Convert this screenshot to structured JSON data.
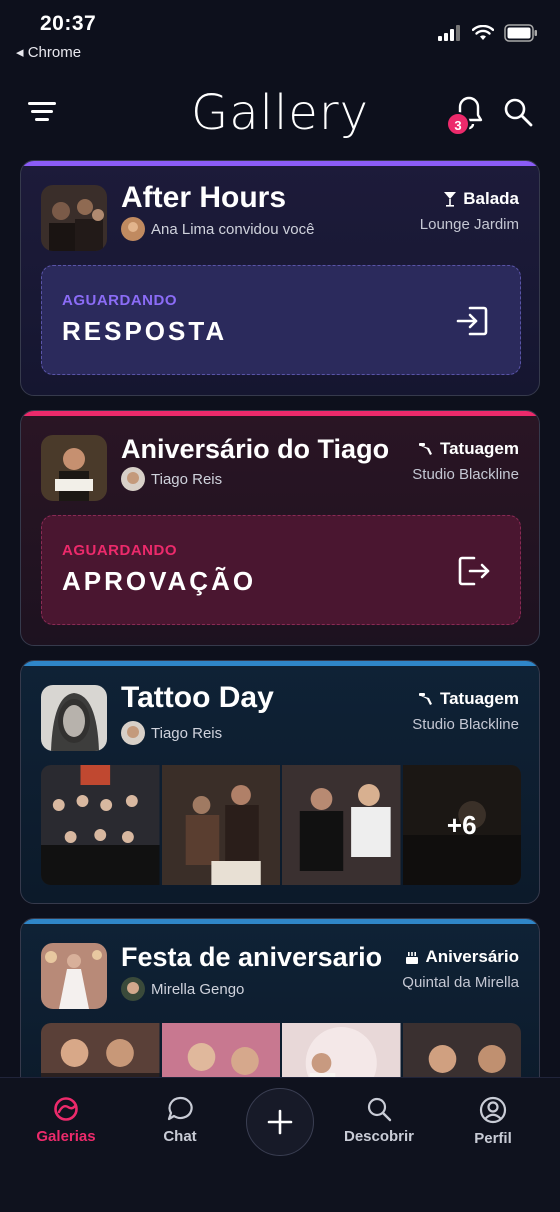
{
  "status_bar": {
    "time": "20:37",
    "back_label": "◂ Chrome"
  },
  "header": {
    "logo": "Gallery",
    "notification_count": "3"
  },
  "cards": [
    {
      "title": "After Hours",
      "host": "Ana Lima convidou você",
      "category": "Balada",
      "venue": "Lounge Jardim",
      "status_label": "AGUARDANDO",
      "status_value": "RESPOSTA",
      "accent": "#8b5cf6"
    },
    {
      "title": "Aniversário do Tiago",
      "host": "Tiago Reis",
      "category": "Tatuagem",
      "venue": "Studio Blackline",
      "status_label": "AGUARDANDO",
      "status_value": "APROVAÇÃO",
      "accent": "#ec2a6b"
    },
    {
      "title": "Tattoo Day",
      "host": "Tiago Reis",
      "category": "Tatuagem",
      "venue": "Studio Blackline",
      "more_photos": "+6",
      "accent": "#2f86c8"
    },
    {
      "title": "Festa de aniversario",
      "host": "Mirella Gengo",
      "category": "Aniversário",
      "venue": "Quintal da Mirella",
      "accent": "#2f86c8"
    }
  ],
  "tabs": {
    "galerias": "Galerias",
    "chat": "Chat",
    "descobrir": "Descobrir",
    "perfil": "Perfil"
  },
  "colors": {
    "active_tab": "#ec2a6b",
    "background": "#0d101c"
  }
}
